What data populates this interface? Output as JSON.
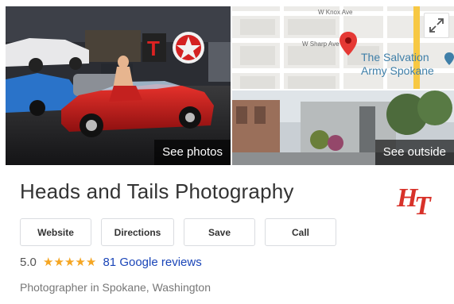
{
  "photos": {
    "see_photos_label": "See photos",
    "see_outside_label": "See outside"
  },
  "map": {
    "street_top": "W Knox Ave",
    "street_mid": "W Sharp Ave",
    "poi_name_line1": "The Salvation",
    "poi_name_line2": "Army Spokane"
  },
  "business": {
    "name": "Heads and Tails Photography",
    "logo_text": "HT",
    "category": "Photographer in Spokane, Washington"
  },
  "actions": [
    "Website",
    "Directions",
    "Save",
    "Call"
  ],
  "rating": {
    "value": "5.0",
    "stars": 5,
    "reviews_label": "81 Google reviews"
  },
  "colors": {
    "star": "#f5a623",
    "link": "#1a45b8",
    "logo": "#d8322a",
    "map_pin": "#e53935"
  }
}
